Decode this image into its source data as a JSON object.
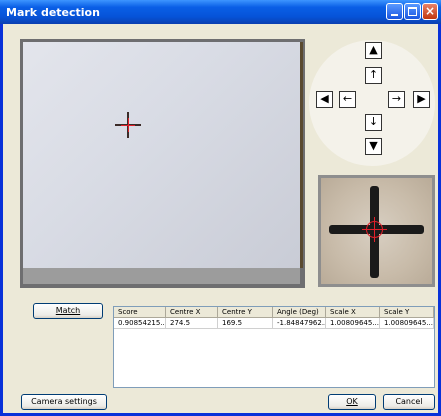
{
  "window": {
    "title": "Mark detection"
  },
  "titlebar_buttons": {
    "minimize_icon": "minimize-icon",
    "maximize_icon": "maximize-icon",
    "close_icon": "close-icon"
  },
  "jog": {
    "up_fast": "▲",
    "up": "↑",
    "left_fast": "◀",
    "left": "←",
    "right": "→",
    "right_fast": "▶",
    "down": "↓",
    "down_fast": "▼"
  },
  "buttons": {
    "match": "Match",
    "camera_settings": "Camera settings",
    "ok": "OK",
    "cancel": "Cancel"
  },
  "results": {
    "columns": [
      "Score",
      "Centre X",
      "Centre Y",
      "Angle (Deg)",
      "Scale X",
      "Scale Y"
    ],
    "rows": [
      [
        "0.90854215...",
        "274.5",
        "169.5",
        "-1.84847962...",
        "1.00809645...",
        "1.00809645..."
      ]
    ]
  },
  "colors": {
    "titlebar": "#0653d8",
    "window_bg": "#ece9d8",
    "marker": "#e0202a"
  }
}
